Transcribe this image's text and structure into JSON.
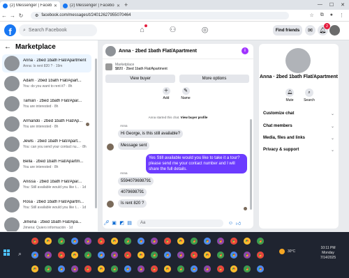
{
  "browser": {
    "tabs": [
      {
        "label": "(2) Messenger | Facebook",
        "active": true
      },
      {
        "label": "(2) Messenger | Facebook",
        "active": false
      }
    ],
    "url": "facebook.com/messages/t/24012627955070464"
  },
  "fb_nav": {
    "search_placeholder": "Search Facebook",
    "find_friends_label": "Find friends",
    "notifications_count": "2"
  },
  "left_panel": {
    "title": "Marketplace",
    "chats": [
      {
        "name": "Anna · 2bed 1bath Flat/Apartment",
        "preview": "Anna: Is rent 820 ? · 19m",
        "active": true
      },
      {
        "name": "Adam · 2bed 1bath Flat/Apart...",
        "preview": "You: do you want to rent it? · 8h",
        "active": false
      },
      {
        "name": "Tamari · 2bed 1bath Flat/Apar...",
        "preview": "You are interested · 8h",
        "active": false
      },
      {
        "name": "Armando · 2bed 1bath Flat/Ap...",
        "preview": "You are interested · 8h",
        "active": false
      },
      {
        "name": "Jewls · 2bed 1bath Flat/Apart...",
        "preview": "You: can you send your contact nu... · 8h",
        "active": false
      },
      {
        "name": "Bella · 2bed 1bath Flat/Apartm...",
        "preview": "You are interested · 8h",
        "active": false
      },
      {
        "name": "Anissa · 2bed 1bath Flat/Apar...",
        "preview": "You: Still available would you like t... · 1d",
        "active": false
      },
      {
        "name": "Rosa · 2bed 1bath Flat/Apartm...",
        "preview": "You: Still available would you like t... · 1d",
        "active": false
      },
      {
        "name": "Jimena · 2bed 1bath Flat/Apa...",
        "preview": "Jimena: Quiero información · 1d",
        "active": false
      }
    ]
  },
  "chat": {
    "title": "Anna · 2bed 1bath Flat/Apartment",
    "marketplace_label": "Marketplace",
    "listing": "$820 · 2bed 1bath Flat/Apartment",
    "view_buyer_label": "View buyer",
    "more_options_label": "More options",
    "actions": [
      {
        "label": "Add"
      },
      {
        "label": "Name"
      }
    ],
    "system_prefix": "Anna started this chat.",
    "system_link": "View buyer profile",
    "sender1": "Anna",
    "msg1": "Hi George, is this still available?",
    "msg2": "Message sent",
    "msg3": "Yes Still available would you like to take it a tour? please send me your contact number and I will share the full details.",
    "sender2": "Anna",
    "msg4": "5594079698791",
    "msg5": "4079698791",
    "msg6": "Is rent 820 ?",
    "composer_placeholder": "Aa"
  },
  "right_panel": {
    "name": "Anna · 2bed 1bath Flat/Apartment",
    "mute_label": "Mute",
    "search_label": "Search",
    "sections": [
      "Customize chat",
      "Chat members",
      "Media, files and links",
      "Privacy & support"
    ]
  },
  "taskbar": {
    "temperature": "30°C",
    "time": "10:11 PM",
    "day": "Monday",
    "date": "7/14/2025"
  },
  "colors": {
    "brand_blue": "#1877f2",
    "outgoing_bubble": "#6c3bff",
    "info_button": "#a033ff"
  }
}
